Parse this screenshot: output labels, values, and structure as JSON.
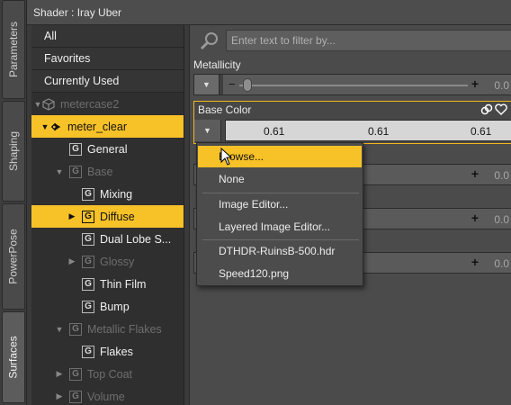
{
  "vtabs": [
    {
      "label": "Parameters",
      "active": false
    },
    {
      "label": "Shaping",
      "active": false
    },
    {
      "label": "PowerPose",
      "active": false
    },
    {
      "label": "Surfaces",
      "active": true
    }
  ],
  "title": "Shader : Iray Uber",
  "tree": {
    "filters": [
      "All",
      "Favorites",
      "Currently Used"
    ],
    "items": [
      {
        "label": "metercase2",
        "state": "dim"
      },
      {
        "label": "meter_clear",
        "state": "selected"
      },
      {
        "label": "General",
        "state": "normal"
      },
      {
        "label": "Base",
        "state": "dim"
      },
      {
        "label": "Mixing",
        "state": "normal"
      },
      {
        "label": "Diffuse",
        "state": "selected"
      },
      {
        "label": "Dual Lobe S...",
        "state": "normal"
      },
      {
        "label": "Glossy",
        "state": "dim"
      },
      {
        "label": "Thin Film",
        "state": "normal"
      },
      {
        "label": "Bump",
        "state": "normal"
      },
      {
        "label": "Metallic Flakes",
        "state": "dim"
      },
      {
        "label": "Flakes",
        "state": "normal"
      },
      {
        "label": "Top Coat",
        "state": "dim"
      },
      {
        "label": "Volume",
        "state": "dim"
      }
    ]
  },
  "search": {
    "placeholder": "Enter text to filter by..."
  },
  "properties": {
    "metallicity": {
      "label": "Metallicity",
      "value": "0.0"
    },
    "base_color": {
      "label": "Base Color",
      "values": [
        "0.61",
        "0.61",
        "0.61"
      ]
    },
    "hidden_values": [
      "0.0",
      "0.0",
      "0.0"
    ]
  },
  "menu": {
    "items": [
      "Browse...",
      "None",
      "Image Editor...",
      "Layered Image Editor...",
      "DTHDR-RuinsB-500.hdr",
      "Speed120.png"
    ],
    "highlighted": "Browse..."
  },
  "colors": {
    "accent": "#f7c128",
    "panel": "#2f2f2f",
    "background": "#4b4b4b"
  }
}
